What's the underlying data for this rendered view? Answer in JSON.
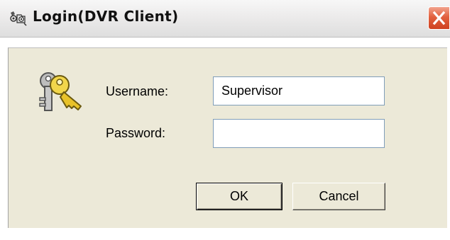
{
  "window": {
    "title": "Login(DVR Client)"
  },
  "icons": {
    "app": "dvr-app-icon",
    "keys": "keys-icon",
    "close": "close-icon"
  },
  "form": {
    "username_label": "Username:",
    "username_value": "Supervisor",
    "password_label": "Password:",
    "password_value": ""
  },
  "buttons": {
    "ok_label": "OK",
    "cancel_label": "Cancel"
  },
  "colors": {
    "close_button": "#e2613f",
    "dialog_background": "#ece9d8",
    "field_border": "#7f9db9"
  }
}
